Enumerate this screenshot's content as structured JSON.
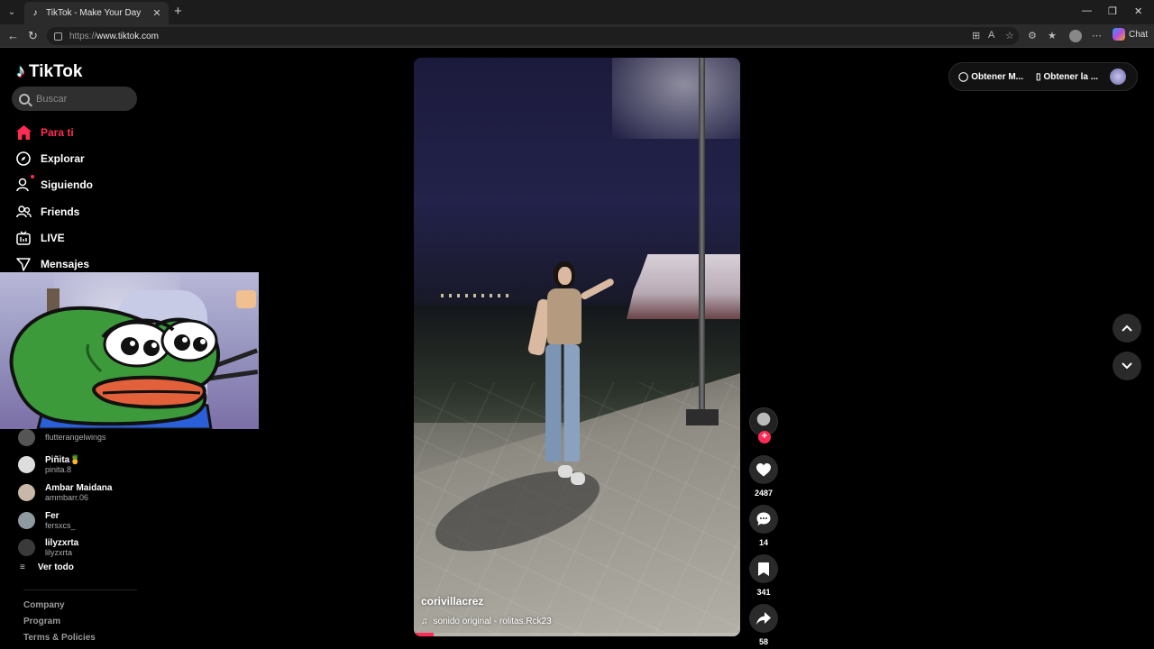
{
  "browser": {
    "tab_title": "TikTok - Make Your Day",
    "url_scheme": "https://",
    "url_host": "www.tiktok.com",
    "chat_label": "Chat"
  },
  "app": {
    "logo_text": "TikTok",
    "search_placeholder": "Buscar"
  },
  "nav": [
    {
      "label": "Para ti",
      "icon": "home-icon",
      "active": true
    },
    {
      "label": "Explorar",
      "icon": "compass-icon"
    },
    {
      "label": "Siguiendo",
      "icon": "following-icon"
    },
    {
      "label": "Friends",
      "icon": "friends-icon"
    },
    {
      "label": "LIVE",
      "icon": "live-icon"
    },
    {
      "label": "Mensajes",
      "icon": "send-icon"
    }
  ],
  "following_accounts": [
    {
      "name": "",
      "handle": "flutterangelwings"
    },
    {
      "name": "Piñita🍍",
      "handle": "pinita.8"
    },
    {
      "name": "Ambar Maidana",
      "handle": "ammbarr.06"
    },
    {
      "name": "Fer",
      "handle": "fersxcs_"
    },
    {
      "name": "lilyzxrta",
      "handle": "lilyzxrta"
    }
  ],
  "see_all": "Ver todo",
  "footer_links": [
    "Company",
    "Program",
    "Terms & Policies"
  ],
  "video": {
    "author": "corivillacrez",
    "sound": "sonido original - rolitas.Rck23",
    "progress_fraction": 0.06
  },
  "actions": {
    "likes": "2487",
    "comments": "14",
    "saves": "341",
    "shares": "58"
  },
  "topright": {
    "coins_label": "Obtener M...",
    "app_label": "Obtener la ..."
  },
  "colors": {
    "accent": "#fe2c55",
    "background": "#000000",
    "button_bg": "#2a2a2a"
  }
}
